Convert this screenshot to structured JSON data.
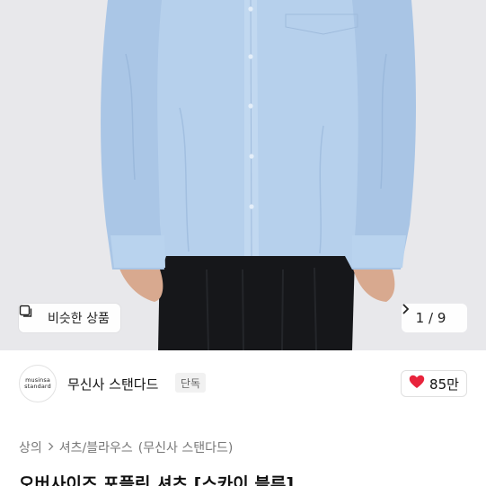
{
  "hero": {
    "similar_label": "비슷한 상품",
    "similar_icon": "similar-items-icon",
    "pager_current": "1",
    "pager_separator": "/",
    "pager_total": "9",
    "pager_next_icon": "chevron-right-icon"
  },
  "brand": {
    "logo_line1": "musinsa",
    "logo_line2": "standard",
    "name": "무신사 스탠다드",
    "badge": "단독",
    "like_count": "85만",
    "like_icon": "heart-icon",
    "like_color": "#e8243c"
  },
  "breadcrumb": {
    "items": [
      "상의",
      "셔츠/블라우스",
      "(무신사 스탠다드)"
    ],
    "separator_icon": "chevron-right-icon"
  },
  "product": {
    "title": "오버사이즈 포플린 셔츠 [스카이 블루]"
  }
}
